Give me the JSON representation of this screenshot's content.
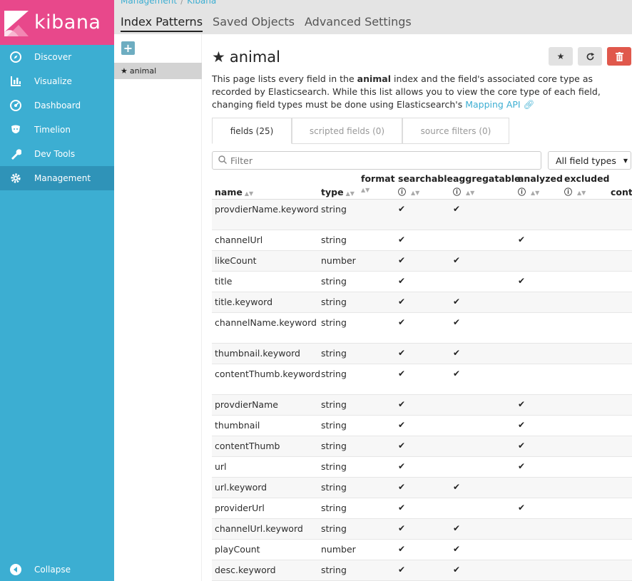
{
  "app": {
    "logo_text": "kibana"
  },
  "sidebar": {
    "items": [
      {
        "label": "Discover",
        "icon": "compass-icon"
      },
      {
        "label": "Visualize",
        "icon": "bar-chart-icon"
      },
      {
        "label": "Dashboard",
        "icon": "dashboard-icon"
      },
      {
        "label": "Timelion",
        "icon": "timelion-icon"
      },
      {
        "label": "Dev Tools",
        "icon": "wrench-icon"
      },
      {
        "label": "Management",
        "icon": "gear-icon"
      }
    ],
    "collapse_label": "Collapse"
  },
  "breadcrumb": {
    "parent": "Management",
    "sep": "/",
    "current": "Kibana"
  },
  "top_tabs": [
    "Index Patterns",
    "Saved Objects",
    "Advanced Settings"
  ],
  "index_list": {
    "add_label": "+",
    "items": [
      "animal"
    ]
  },
  "page": {
    "title": "animal",
    "desc_pre": "This page lists every field in the ",
    "desc_bold": "animal",
    "desc_post": " index and the field's associated core type as recorded by Elasticsearch. While this list allows you to view the core type of each field, changing field types must be done using Elasticsearch's ",
    "desc_link": "Mapping API"
  },
  "tabs": [
    "fields (25)",
    "scripted fields (0)",
    "source filters (0)"
  ],
  "filter": {
    "placeholder": "Filter"
  },
  "type_select": {
    "value": "All field types"
  },
  "columns": [
    "name",
    "type",
    "format",
    "searchable",
    "aggregatable",
    "analyzed",
    "excluded",
    "cont"
  ],
  "rows": [
    {
      "name": "provdierName.keyword",
      "type": "string",
      "searchable": "✔",
      "aggregatable": "✔",
      "analyzed": ""
    },
    {
      "name": "channelUrl",
      "type": "string",
      "searchable": "✔",
      "aggregatable": "",
      "analyzed": "✔"
    },
    {
      "name": "likeCount",
      "type": "number",
      "searchable": "✔",
      "aggregatable": "✔",
      "analyzed": ""
    },
    {
      "name": "title",
      "type": "string",
      "searchable": "✔",
      "aggregatable": "",
      "analyzed": "✔"
    },
    {
      "name": "title.keyword",
      "type": "string",
      "searchable": "✔",
      "aggregatable": "✔",
      "analyzed": ""
    },
    {
      "name": "channelName.keyword",
      "type": "string",
      "searchable": "✔",
      "aggregatable": "✔",
      "analyzed": ""
    },
    {
      "name": "thumbnail.keyword",
      "type": "string",
      "searchable": "✔",
      "aggregatable": "✔",
      "analyzed": ""
    },
    {
      "name": "contentThumb.keyword",
      "type": "string",
      "searchable": "✔",
      "aggregatable": "✔",
      "analyzed": ""
    },
    {
      "name": "provdierName",
      "type": "string",
      "searchable": "✔",
      "aggregatable": "",
      "analyzed": "✔"
    },
    {
      "name": "thumbnail",
      "type": "string",
      "searchable": "✔",
      "aggregatable": "",
      "analyzed": "✔"
    },
    {
      "name": "contentThumb",
      "type": "string",
      "searchable": "✔",
      "aggregatable": "",
      "analyzed": "✔"
    },
    {
      "name": "url",
      "type": "string",
      "searchable": "✔",
      "aggregatable": "",
      "analyzed": "✔"
    },
    {
      "name": "url.keyword",
      "type": "string",
      "searchable": "✔",
      "aggregatable": "✔",
      "analyzed": ""
    },
    {
      "name": "providerUrl",
      "type": "string",
      "searchable": "✔",
      "aggregatable": "",
      "analyzed": "✔"
    },
    {
      "name": "channelUrl.keyword",
      "type": "string",
      "searchable": "✔",
      "aggregatable": "✔",
      "analyzed": ""
    },
    {
      "name": "playCount",
      "type": "number",
      "searchable": "✔",
      "aggregatable": "✔",
      "analyzed": ""
    },
    {
      "name": "desc.keyword",
      "type": "string",
      "searchable": "✔",
      "aggregatable": "✔",
      "analyzed": ""
    }
  ]
}
